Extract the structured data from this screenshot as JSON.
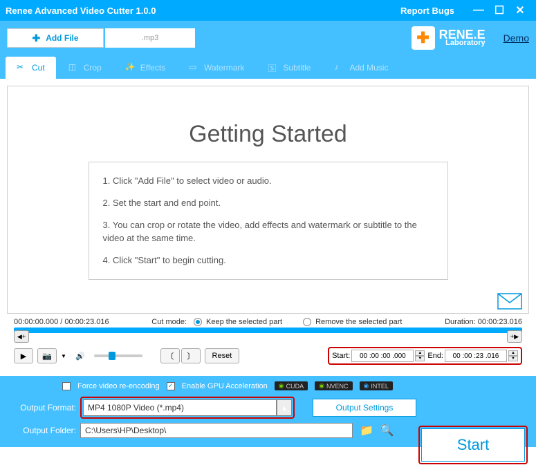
{
  "app": {
    "title": "Renee Advanced Video Cutter 1.0.0",
    "report_bugs": "Report Bugs",
    "demo": "Demo",
    "brand": "RENE.E",
    "brand_sub": "Laboratory"
  },
  "toolbar": {
    "add_file": "Add File",
    "current_file": ".mp3"
  },
  "tabs": [
    {
      "label": "Cut",
      "active": true
    },
    {
      "label": "Crop",
      "active": false
    },
    {
      "label": "Effects",
      "active": false
    },
    {
      "label": "Watermark",
      "active": false
    },
    {
      "label": "Subtitle",
      "active": false
    },
    {
      "label": "Add Music",
      "active": false
    }
  ],
  "getting_started": {
    "title": "Getting Started",
    "steps": [
      "1. Click \"Add File\" to select video or audio.",
      "2. Set the start and end point.",
      "3. You can crop or rotate the video, add effects and watermark or subtitle to the video at the same time.",
      "4. Click \"Start\" to begin cutting."
    ]
  },
  "timeline": {
    "position": "00:00:00.000 / 00:00:23.016",
    "cut_mode_label": "Cut mode:",
    "keep_label": "Keep the selected part",
    "remove_label": "Remove the selected part",
    "duration_label": "Duration: 00:00:23.016",
    "reset": "Reset",
    "start_label": "Start:",
    "start_value": "00 :00 :00 .000",
    "end_label": "End:",
    "end_value": "00 :00 :23 .016"
  },
  "encoding": {
    "force_label": "Force video re-encoding",
    "gpu_label": "Enable GPU Acceleration",
    "cuda": "CUDA",
    "nvenc": "NVENC",
    "intel": "INTEL"
  },
  "output": {
    "format_label": "Output Format:",
    "format_value": "MP4 1080P Video (*.mp4)",
    "settings_btn": "Output Settings",
    "folder_label": "Output Folder:",
    "folder_value": "C:\\Users\\HP\\Desktop\\",
    "start_btn": "Start"
  }
}
